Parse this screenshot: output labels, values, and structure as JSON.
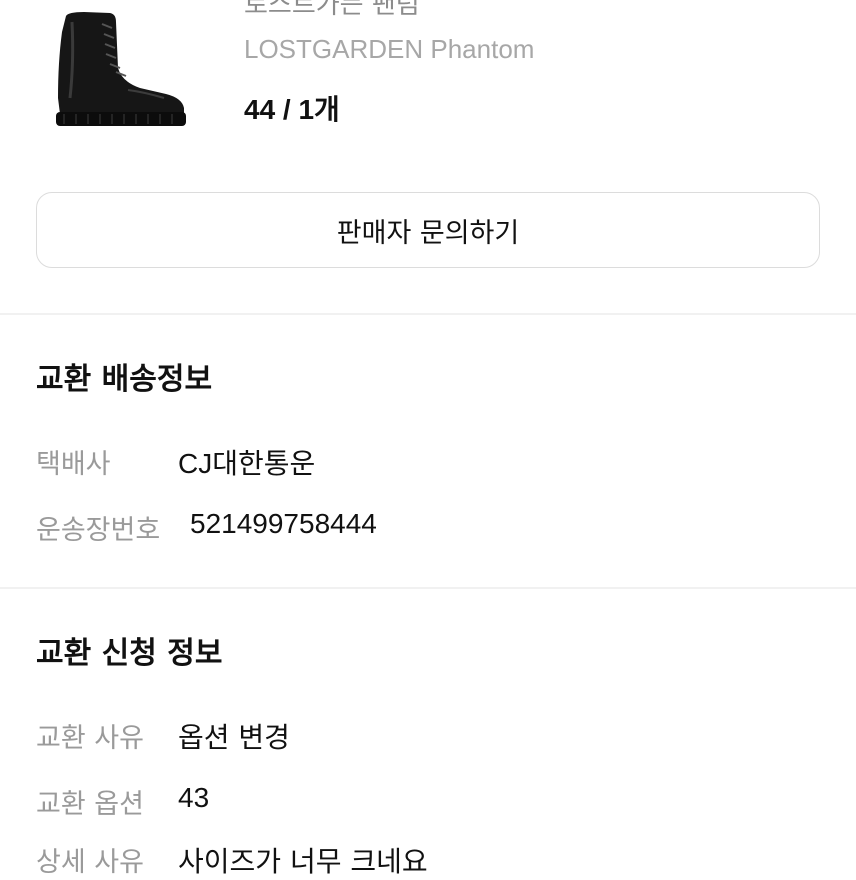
{
  "product": {
    "title": "로스트가든 팬텀",
    "brand": "LOSTGARDEN Phantom",
    "option": "44 / 1개",
    "image_icon": "boot-product-image"
  },
  "inquiry_button": {
    "label": "판매자 문의하기"
  },
  "shipping_section": {
    "title": "교환 배송정보",
    "rows": [
      {
        "label": "택배사",
        "value": "CJ대한통운"
      },
      {
        "label": "운송장번호",
        "value": "521499758444"
      }
    ]
  },
  "request_section": {
    "title": "교환 신청 정보",
    "rows": [
      {
        "label": "교환 사유",
        "value": "옵션 변경"
      },
      {
        "label": "교환 옵션",
        "value": "43"
      },
      {
        "label": "상세 사유",
        "value": "사이즈가 너무 크네요"
      }
    ]
  }
}
